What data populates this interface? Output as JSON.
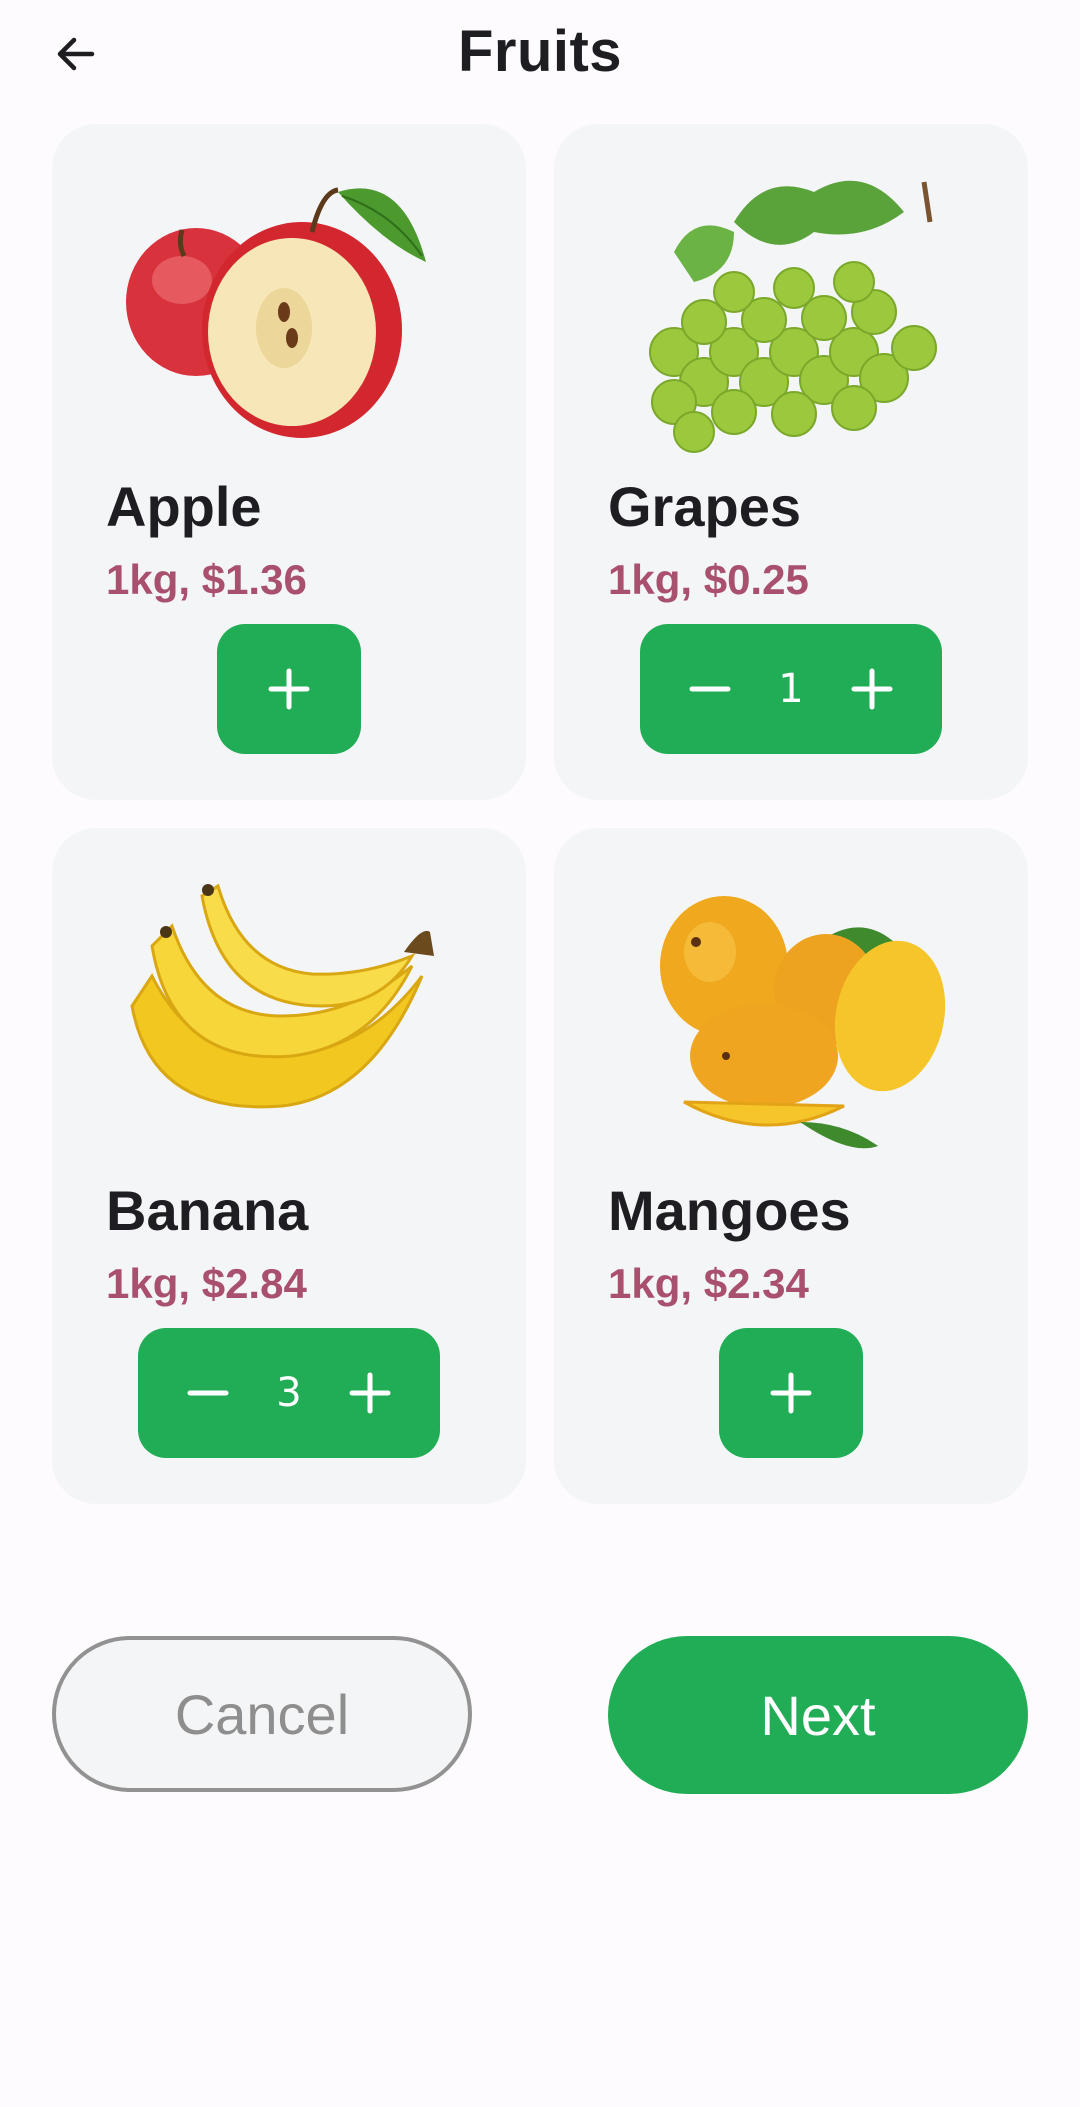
{
  "header": {
    "title": "Fruits",
    "back_icon": "arrow-left-icon"
  },
  "products": [
    {
      "name": "Apple",
      "price": "1kg, $1.36",
      "quantity": null
    },
    {
      "name": "Grapes",
      "price": "1kg, $0.25",
      "quantity": "1"
    },
    {
      "name": "Banana",
      "price": "1kg, $2.84",
      "quantity": "3"
    },
    {
      "name": "Mangoes",
      "price": "1kg, $2.34",
      "quantity": null
    }
  ],
  "actions": {
    "cancel_label": "Cancel",
    "next_label": "Next"
  },
  "colors": {
    "accent": "#21ad56",
    "price": "#a8506e",
    "card": "#f4f5f7",
    "background": "#fdfbfd"
  }
}
